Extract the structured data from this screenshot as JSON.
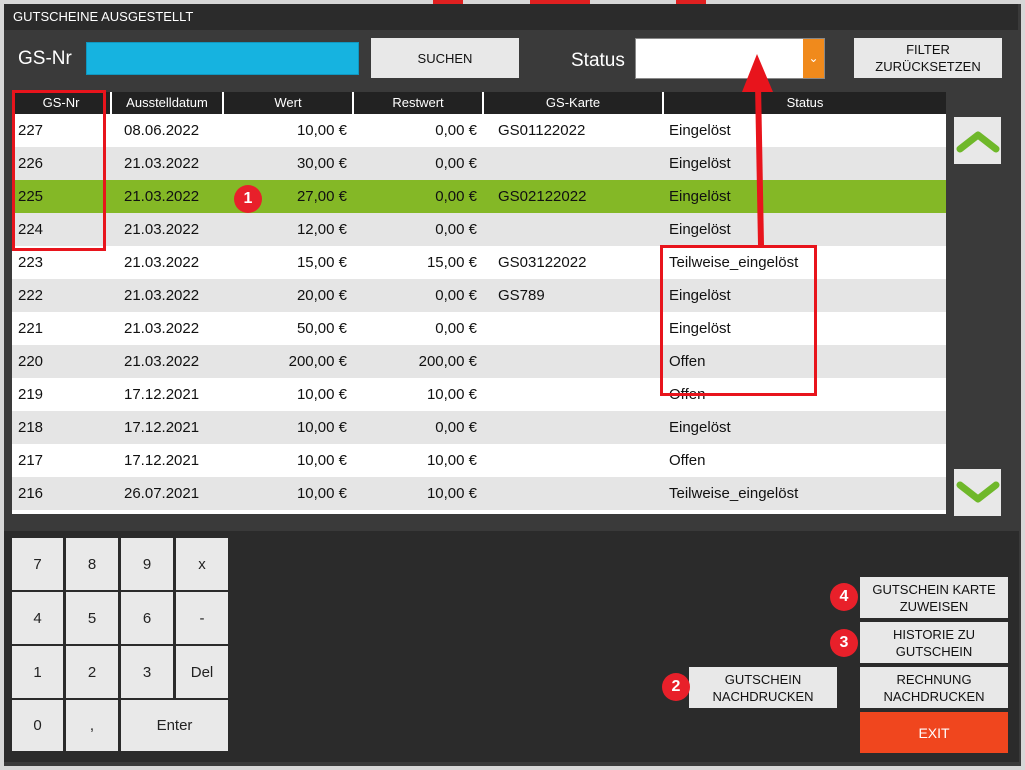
{
  "window": {
    "title": "GUTSCHEINE AUSGESTELLT"
  },
  "search": {
    "label": "GS-Nr",
    "value": "",
    "button": "SUCHEN"
  },
  "status_filter": {
    "label": "Status",
    "selected": "",
    "reset_line1": "FILTER",
    "reset_line2": "ZURÜCKSETZEN"
  },
  "table": {
    "columns": [
      "GS-Nr",
      "Ausstelldatum",
      "Wert",
      "Restwert",
      "GS-Karte",
      "Status"
    ],
    "rows": [
      [
        "227",
        "08.06.2022",
        "10,00 €",
        "0,00 €",
        "GS01122022",
        "Eingelöst"
      ],
      [
        "226",
        "21.03.2022",
        "30,00 €",
        "0,00 €",
        "",
        "Eingelöst"
      ],
      [
        "225",
        "21.03.2022",
        "27,00 €",
        "0,00 €",
        "GS02122022",
        "Eingelöst"
      ],
      [
        "224",
        "21.03.2022",
        "12,00 €",
        "0,00 €",
        "",
        "Eingelöst"
      ],
      [
        "223",
        "21.03.2022",
        "15,00 €",
        "15,00 €",
        "GS03122022",
        "Teilweise_eingelöst"
      ],
      [
        "222",
        "21.03.2022",
        "20,00 €",
        "0,00 €",
        "GS789",
        "Eingelöst"
      ],
      [
        "221",
        "21.03.2022",
        "50,00 €",
        "0,00 €",
        "",
        "Eingelöst"
      ],
      [
        "220",
        "21.03.2022",
        "200,00 €",
        "200,00 €",
        "",
        "Offen"
      ],
      [
        "219",
        "17.12.2021",
        "10,00 €",
        "10,00 €",
        "",
        "Offen"
      ],
      [
        "218",
        "17.12.2021",
        "10,00 €",
        "0,00 €",
        "",
        "Eingelöst"
      ],
      [
        "217",
        "17.12.2021",
        "10,00 €",
        "10,00 €",
        "",
        "Offen"
      ],
      [
        "216",
        "26.07.2021",
        "10,00 €",
        "10,00 €",
        "",
        "Teilweise_eingelöst"
      ]
    ],
    "selected_row_index": 2
  },
  "keypad": {
    "keys": [
      "7",
      "8",
      "9",
      "x",
      "4",
      "5",
      "6",
      "-",
      "1",
      "2",
      "3",
      "Del",
      "0",
      ",",
      "Enter"
    ]
  },
  "actions": {
    "assign_card_line1": "GUTSCHEIN KARTE",
    "assign_card_line2": "ZUWEISEN",
    "history_line1": "HISTORIE ZU",
    "history_line2": "GUTSCHEIN",
    "reprint_voucher_line1": "GUTSCHEIN",
    "reprint_voucher_line2": "NACHDRUCKEN",
    "reprint_invoice_line1": "RECHNUNG",
    "reprint_invoice_line2": "NACHDRUCKEN",
    "exit": "EXIT"
  },
  "annotations": {
    "badge1": "1",
    "badge2": "2",
    "badge3": "3",
    "badge4": "4"
  },
  "colors": {
    "accent_blue": "#16b3e0",
    "selected_row": "#84b826",
    "exit": "#f0461e",
    "dropdown_arrow": "#f08a1c",
    "annotation_red": "#e8141c"
  }
}
